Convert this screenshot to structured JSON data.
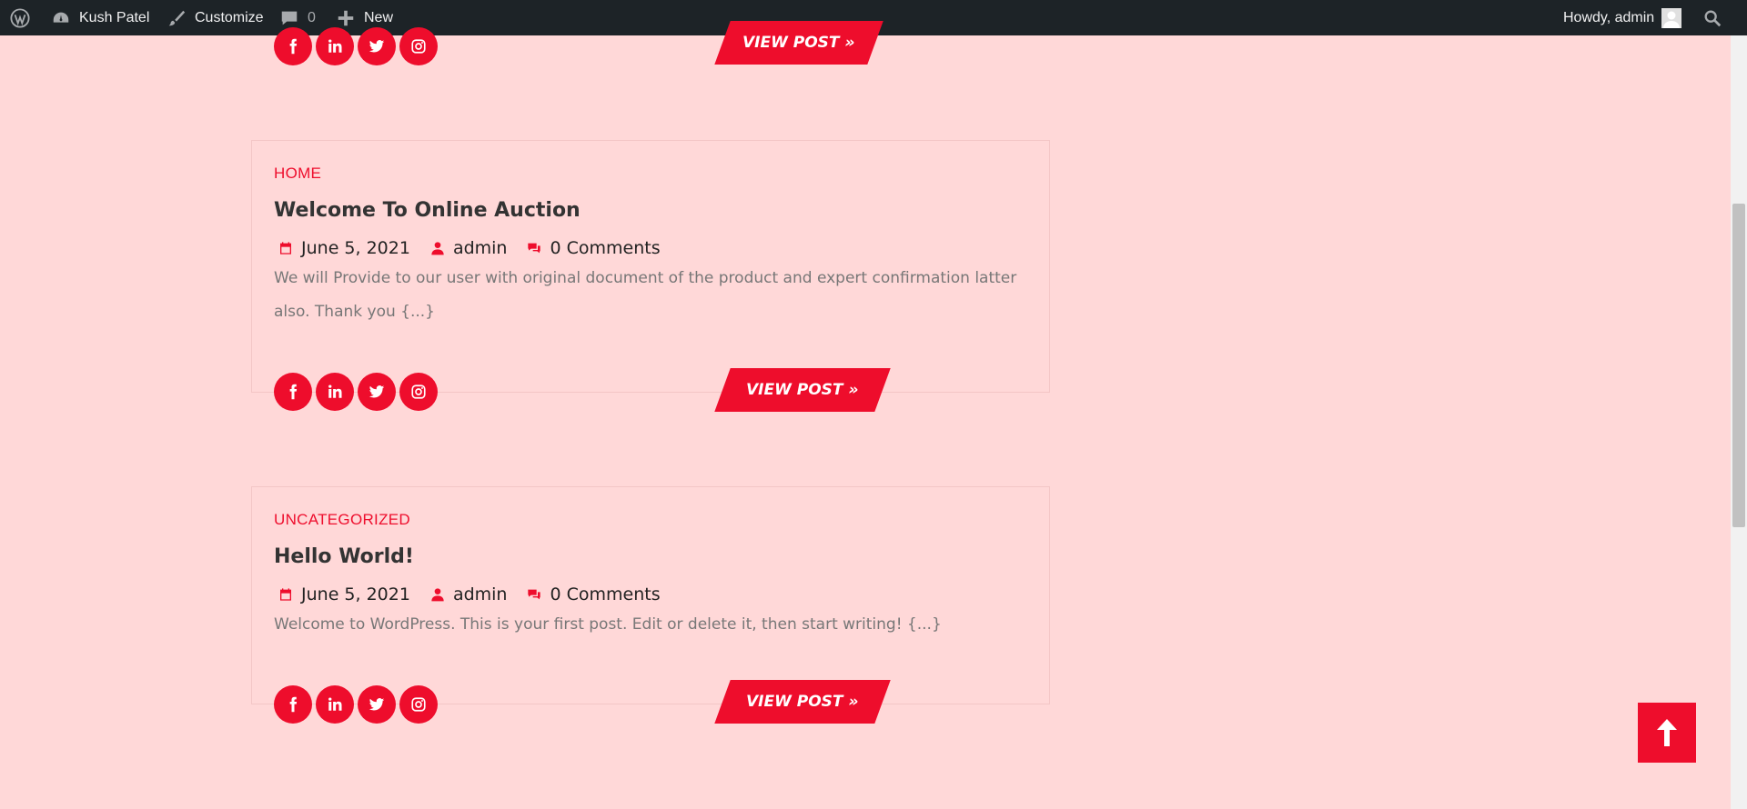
{
  "admin_bar": {
    "site_name": "Kush Patel",
    "customize": "Customize",
    "comments_count": "0",
    "new_label": "New",
    "howdy": "Howdy, admin"
  },
  "posts": [
    {
      "category": "HOME",
      "title": "Welcome To Online Auction",
      "date": "June 5, 2021",
      "author": "admin",
      "comments": "0 Comments",
      "excerpt": "We will Provide to our user with original document of the product and expert confirmation latter also. Thank you {...}",
      "view_label": "VIEW POST »"
    },
    {
      "category": "UNCATEGORIZED",
      "title": "Hello World!",
      "date": "June 5, 2021",
      "author": "admin",
      "comments": "0 Comments",
      "excerpt": "Welcome to WordPress. This is your first post. Edit or delete it, then start writing! {...}",
      "view_label": "VIEW POST »"
    }
  ],
  "top_partial": {
    "view_label": "VIEW POST »"
  },
  "social_icons": [
    "facebook-icon",
    "linkedin-icon",
    "twitter-icon",
    "instagram-icon"
  ],
  "colors": {
    "accent": "#ee0d2c",
    "background": "#ffd8d8",
    "admin_bar": "#1d2327"
  }
}
